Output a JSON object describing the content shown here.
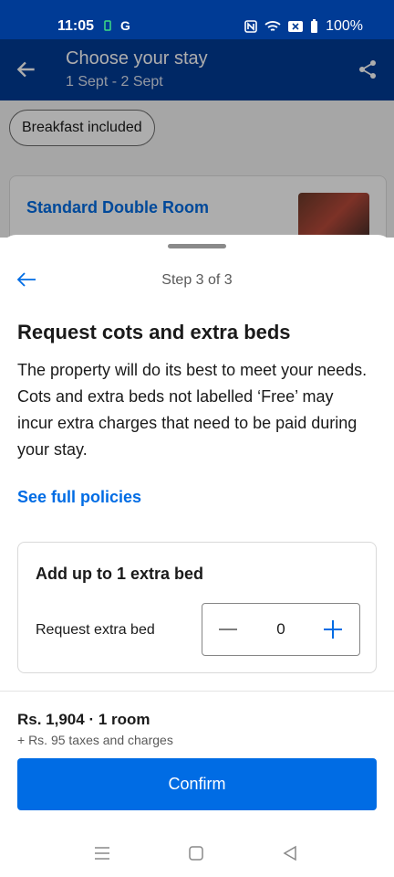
{
  "status_bar": {
    "time": "11:05",
    "left_icons": [
      "battery-saver-icon",
      "G"
    ],
    "battery": "100%"
  },
  "header": {
    "title": "Choose your stay",
    "dates": "1 Sept - 2 Sept"
  },
  "background": {
    "chip_label": "Breakfast included",
    "room_title": "Standard Double Room"
  },
  "sheet": {
    "step": "Step 3 of 3",
    "title": "Request cots and extra beds",
    "description": "The property will do its best to meet your needs. Cots and extra beds not labelled ‘Free’ may incur extra charges that need to be paid during your stay.",
    "policies_link": "See full policies",
    "extra_bed": {
      "title": "Add up to 1 extra bed",
      "label": "Request extra bed",
      "value": "0"
    }
  },
  "footer": {
    "price": "Rs. 1,904 · 1 room",
    "taxes": "+ Rs. 95 taxes and charges",
    "confirm_label": "Confirm"
  },
  "colors": {
    "brand_dark": "#003b95",
    "accent": "#006ce4"
  }
}
